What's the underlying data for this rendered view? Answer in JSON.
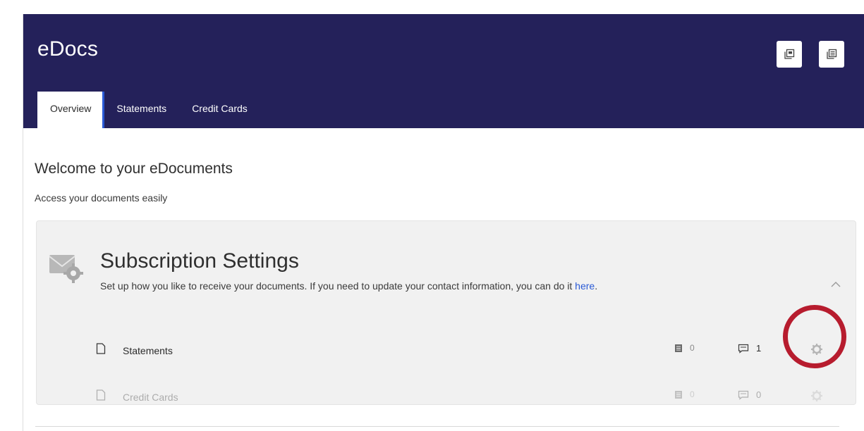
{
  "app": {
    "title": "eDocs"
  },
  "header": {
    "buttons": [
      {
        "icon": "copy-document-icon"
      },
      {
        "icon": "documents-icon"
      }
    ]
  },
  "tabs": [
    {
      "label": "Overview",
      "active": true
    },
    {
      "label": "Statements",
      "active": false
    },
    {
      "label": "Credit Cards",
      "active": false
    }
  ],
  "welcome": {
    "heading": "Welcome to your eDocuments",
    "subtitle": "Access your documents easily"
  },
  "subscription": {
    "title": "Subscription Settings",
    "description": "Set up how you like to receive your documents. If you need to update your contact information, you can do it ",
    "link_text": "here",
    "description_end": ".",
    "icon": "envelope-gear-icon",
    "rows": [
      {
        "label": "Statements",
        "email_count": "0",
        "sms_count": "1",
        "enabled": true
      },
      {
        "label": "Credit Cards",
        "email_count": "0",
        "sms_count": "0",
        "enabled": false
      }
    ]
  },
  "colors": {
    "header_bg": "#24215a",
    "accent": "#2a5ad6",
    "highlight": "#b71c2e",
    "panel_bg": "#f1f1f1"
  }
}
